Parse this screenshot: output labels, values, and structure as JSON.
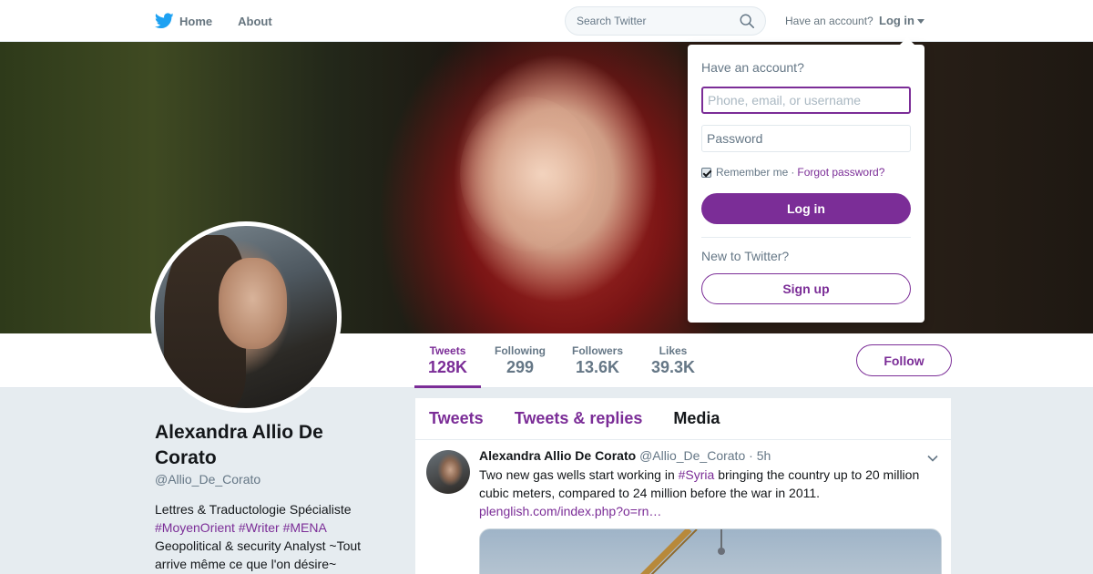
{
  "colors": {
    "accent": "#7b2d97",
    "brand_blue": "#1da1f2",
    "muted": "#657786",
    "background": "#e6ecf0"
  },
  "nav": {
    "home_label": "Home",
    "home_icon": "twitter-bird-icon",
    "about_label": "About",
    "search_placeholder": "Search Twitter",
    "search_icon": "search-icon",
    "have_account": "Have an account?",
    "login_label": "Log in",
    "login_caret_icon": "caret-down-icon"
  },
  "login_dropdown": {
    "title": "Have an account?",
    "username_placeholder": "Phone, email, or username",
    "password_placeholder": "Password",
    "remember_label": "Remember me",
    "remember_checked": true,
    "separator": "·",
    "forgot_label": "Forgot password?",
    "login_button": "Log in",
    "new_label": "New to Twitter?",
    "signup_button": "Sign up"
  },
  "profile": {
    "name": "Alexandra Allio De Corato",
    "handle": "@Allio_De_Corato",
    "bio_line1": "Lettres & Traductologie Spécialiste",
    "bio_hashtags": [
      "#MoyenOrient",
      "#Writer",
      "#MENA"
    ],
    "bio_line3": "Geopolitical & security Analyst ~Tout arrive même ce que l'on désire~"
  },
  "stats": [
    {
      "label": "Tweets",
      "value": "128K",
      "active": true
    },
    {
      "label": "Following",
      "value": "299",
      "active": false
    },
    {
      "label": "Followers",
      "value": "13.6K",
      "active": false
    },
    {
      "label": "Likes",
      "value": "39.3K",
      "active": false
    }
  ],
  "follow_button": "Follow",
  "timeline": {
    "tabs": [
      {
        "label": "Tweets",
        "active": false
      },
      {
        "label": "Tweets & replies",
        "active": false
      },
      {
        "label": "Media",
        "active": true
      }
    ],
    "tweet": {
      "author_name": "Alexandra Allio De Corato",
      "author_handle": "@Allio_De_Corato",
      "separator": "·",
      "time": "5h",
      "text_before": "Two new gas wells start working in ",
      "hashtag": "#Syria",
      "text_after": " bringing the country up to 20 million cubic meters, compared to 24 million before the war in 2011.",
      "link": "plenglish.com/index.php?o=rn…",
      "menu_icon": "chevron-down-icon"
    }
  }
}
